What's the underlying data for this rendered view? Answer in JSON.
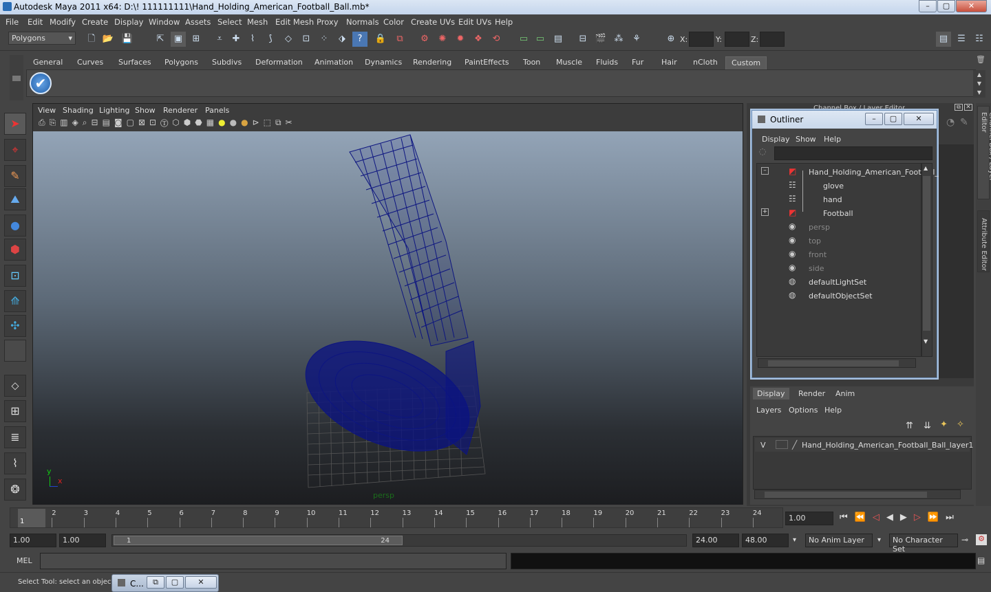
{
  "app": {
    "title": "Autodesk Maya 2011 x64: D:\\! 111111111\\Hand_Holding_American_Football_Ball.mb*"
  },
  "menus": [
    "File",
    "Edit",
    "Modify",
    "Create",
    "Display",
    "Window",
    "Assets",
    "Select",
    "Mesh",
    "Edit Mesh",
    "Proxy",
    "Normals",
    "Color",
    "Create UVs",
    "Edit UVs",
    "Help"
  ],
  "status": {
    "mode": "Polygons",
    "x_label": "X:",
    "y_label": "Y:",
    "z_label": "Z:"
  },
  "shelf_tabs": [
    "General",
    "Curves",
    "Surfaces",
    "Polygons",
    "Subdivs",
    "Deformation",
    "Animation",
    "Dynamics",
    "Rendering",
    "PaintEffects",
    "Toon",
    "Muscle",
    "Fluids",
    "Fur",
    "Hair",
    "nCloth",
    "Custom"
  ],
  "shelf_selected": "Custom",
  "viewport": {
    "menus": [
      "View",
      "Shading",
      "Lighting",
      "Show",
      "Renderer",
      "Panels"
    ],
    "camera_label": "persp",
    "axis_y": "y",
    "axis_x": "x"
  },
  "channel_box": {
    "title": "Channel Box / Layer Editor"
  },
  "outliner": {
    "title": "Outliner",
    "menus": [
      "Display",
      "Show",
      "Help"
    ],
    "items": [
      {
        "label": "Hand_Holding_American_Football_",
        "dim": false
      },
      {
        "label": "glove",
        "dim": false
      },
      {
        "label": "hand",
        "dim": false
      },
      {
        "label": "Football",
        "dim": false
      },
      {
        "label": "persp",
        "dim": true
      },
      {
        "label": "top",
        "dim": true
      },
      {
        "label": "front",
        "dim": true
      },
      {
        "label": "side",
        "dim": true
      },
      {
        "label": "defaultLightSet",
        "dim": false
      },
      {
        "label": "defaultObjectSet",
        "dim": false
      }
    ]
  },
  "layers": {
    "tabs": [
      "Display",
      "Render",
      "Anim"
    ],
    "menus": [
      "Layers",
      "Options",
      "Help"
    ],
    "visible_flag": "V",
    "layer_name": "Hand_Holding_American_Football_Ball_layer1"
  },
  "side_tabs": [
    "Channel Box / Layer Editor",
    "Attribute Editor"
  ],
  "timeline": {
    "ticks": [
      "1",
      "2",
      "3",
      "4",
      "5",
      "6",
      "7",
      "8",
      "9",
      "10",
      "11",
      "12",
      "13",
      "14",
      "15",
      "16",
      "17",
      "18",
      "19",
      "20",
      "21",
      "22",
      "23",
      "24"
    ],
    "current_marker": "1",
    "current_time": "1.00"
  },
  "range": {
    "start": "1.00",
    "start2": "1.00",
    "slider_start": "1",
    "slider_end": "24",
    "end": "24.00",
    "end2": "48.00",
    "anim_layer": "No Anim Layer",
    "char_set": "No Character Set"
  },
  "mel": {
    "label": "MEL"
  },
  "help": {
    "text": "Select Tool: select an object",
    "mini_window": "C..."
  }
}
